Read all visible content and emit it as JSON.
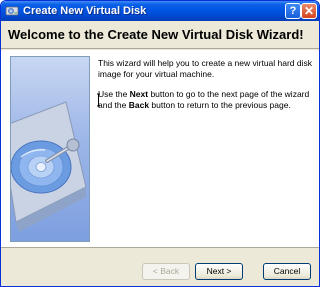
{
  "window": {
    "title": "Create New Virtual Disk",
    "help_glyph": "?",
    "close_glyph": "✕"
  },
  "header": {
    "title": "Welcome to the Create New Virtual Disk Wizard!"
  },
  "body": {
    "paragraph1": "This wizard will help you to create a new virtual hard disk image for your virtual machine.",
    "p2_part1": "Use the ",
    "p2_next": "Next",
    "p2_part2": " button to go to the next page of the wizard and the ",
    "p2_back": "Back",
    "p2_part3": " button to return to the previous page."
  },
  "buttons": {
    "back": "< Back",
    "next": "Next >",
    "cancel": "Cancel"
  },
  "colors": {
    "titlebar": "#0054e3",
    "dialog_bg": "#ece9d8",
    "disk_accent": "#3a7bd5"
  }
}
